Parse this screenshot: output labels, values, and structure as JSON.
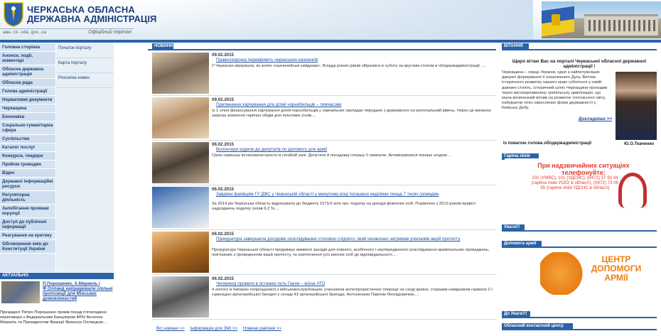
{
  "header": {
    "title_line1": "ЧЕРКАСЬКА ОБЛАСНА",
    "title_line2": "ДЕРЖАВНА АДМІНІСТРАЦІЯ",
    "site_url": "www.ck-oda.gov.ua",
    "portal_label": "Офіційний портал"
  },
  "leftnav": {
    "items": [
      "Головна сторінка",
      "Анонси, події, коментарі",
      "Обласна державна адміністрація",
      "Обласна рада",
      "Голова адміністрації",
      "Нормативні документи",
      "Черкащина",
      "Економіка",
      "Соціально-гуманітарна сфера",
      "Суспільство",
      "Каталог послуг",
      "Конкурси, тендери",
      "Прийом громадян",
      "Відео",
      "Державні інформаційні ресурси",
      "Регуляторна діяльність",
      "Запобігання проявам корупції",
      "Доступ до публічної інформації",
      "Реагування на критику",
      "Обговорення змін до Конституції України"
    ]
  },
  "subnav": {
    "items": [
      "Початок порталу",
      "Карта порталу",
      "Розсилка новин"
    ]
  },
  "actual": {
    "header": "АКТУАЛЬНО",
    "title": "П.Порошенко, А.Меркель і Ф.Олланд напрацювали спільні пропозиції для Мінських домовленостей",
    "text": "Президент Петро Порошенко провів понад п'ятигодинні переговори з Федеральним Канцлером ФРН Ангелою Меркель та Президентом Франції Франсуа Олландом...."
  },
  "news": {
    "tab": "НОВИНИ",
    "items": [
      {
        "date": "09.02.2015",
        "title": "Правоохоронці перевіряють черкаських казначеїв",
        "text": "У Черкасах міркували, як зняти «казначейські кайданки». Владці різних рівнів зібралися в суботу за круглим столом в облдержадміністрації. ..."
      },
      {
        "date": "09.02.2015",
        "title": "Припинення харчування для дітей чорнобильців – тимчасове",
        "text": "Із 1 січня фінансування харчування дітей-чорнобильців у навчальних закладах передано з державного на регіональний рівень. Через це виникла загроза знинення гарячих обідів для пільгових учнів...."
      },
      {
        "date": "06.02.2015",
        "title": "Волонтери ходили до депутатів по допомогу для армії",
        "text": "Свою скриньку встановили просто в сесійній залі. Депутати й посадовці спершу її оминали. Активізувалися пізніше згодом...."
      },
      {
        "date": "06.02.2015",
        "title": "Завдяки фахівцям ГУ ДФС у Черкаській області у минулому році погашено недоїмки понад 7 тисяч громадян",
        "text": "За 2014 рік Черкаська область відрахувала до бюджету 1579,6 млн грн. податку на доходи фізичних осіб. Порівняно з 2013 роком приріст надходжень податку склав 6,2 %...."
      },
      {
        "date": "06.02.2015",
        "title": "Прокуратура завершила досудове розслідування стосовно слідчого, який незаконно затримав учасників акцій протесту",
        "text": "Прокуратура Черкаської області продовжує вживати заходів для повного, всебічного і неупередженого розслідування кримінальних проваджень, пов'язаних з проведенням акцій протесту, та притягнення усіх винних осіб до відповідальності...."
      },
      {
        "date": "06.02.2015",
        "title": "Чигиринці провели в останню путь Героя – воїна АТО",
        "text": "4 лютого в Чигирин попрощалися з військовослужбовцем, учасником антитерористичної операції на сході країни, старшим навідником гармати 2-ї самохідно-артилерійської батареї у складі 43 артилерійської бригади, Антоненком Павлом Леонідовичем...."
      }
    ],
    "links": [
      "Всі новини >>",
      "Інформація для ЗМІ >>",
      "Новини районів >>"
    ]
  },
  "right": {
    "greeting_header": "ВІТАННЯ",
    "greeting_title": "Щиро вітаю Вас на порталі Черкаської обласної державної адміністрації !",
    "greeting_text": "Черкащина – серце України, одне з найпотужніших джерел формування її незалежного Духу. Витоки історичного розвитку нашого краю губляться у сивій давнині століть, історичний шлях Черкащини проходив через високорозвинену трипільську цивілізацію, що мала величезний вплив на розвиток тогочасного світу, набуваючи чітко окреслених форм державності у Київську Добу.",
    "greeting_more": "Докладніше >>",
    "governor_caption": "Із повагою голова облдержадміністрації",
    "governor_name": "Ю.О.Ткаченко",
    "emergency_header": "Гаряча лінія",
    "emergency_title": "При надзвичайних ситуаціях телефонуйте:",
    "emergency_text": "102 (УМВС), 101 (УДСНС), (0472) 37 92 44 (гаряча лінія УСБУ в області), (0472) 73 00 55 (гаряча лінія УДСНС в області)",
    "attention1": "Увага!!!",
    "help_header": "Допомога армії",
    "help_text": "ЦЕНТР ДОПОМОГИ АРМІЇ",
    "attention2": "До Уваги!!!",
    "contact_header": "Обласний контактний центр"
  },
  "colors": {
    "accent_blue": "#2a63a8",
    "link_blue": "#1f4fa6",
    "emergency_red": "#e23b2e",
    "help_orange": "#ee7d12"
  }
}
